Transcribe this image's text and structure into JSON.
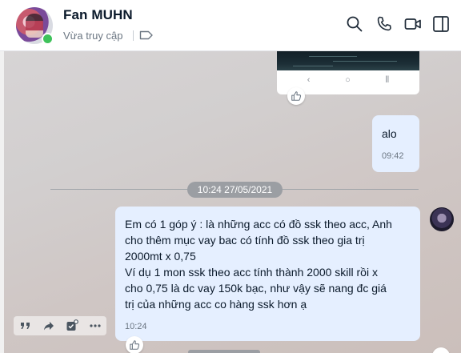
{
  "header": {
    "contact_name": "Fan MUHN",
    "status": "Vừa truy cập",
    "icons": [
      "search-icon",
      "phone-icon",
      "video-call-icon",
      "sidebar-toggle-icon"
    ]
  },
  "chat": {
    "image_message": {
      "nav_buttons": [
        "‹",
        "○",
        "⦀"
      ]
    },
    "outgoing_message": {
      "text": "alo",
      "time": "09:42"
    },
    "date_divider": "10:24 27/05/2021",
    "incoming_message": {
      "lines": [
        "Em có 1 góp ý : là những acc có đồ ssk theo acc, Anh",
        "cho thêm mục vay bac có tính đồ ssk theo gia trị",
        "2000mt x 0,75",
        "Ví dụ 1 mon ssk theo acc tính thành 2000 skill rồi x",
        "cho 0,75 là dc vay 150k bạc, như vậy sẽ nang đc giá",
        "trị của những acc co hàng ssk hơn ạ"
      ],
      "time": "10:24"
    },
    "message_actions": [
      "quote-icon",
      "forward-icon",
      "task-icon",
      "more-icon"
    ]
  },
  "colors": {
    "bubble": "#e5efff",
    "online": "#3ec25a",
    "date_pill": "#9b9ea3"
  }
}
